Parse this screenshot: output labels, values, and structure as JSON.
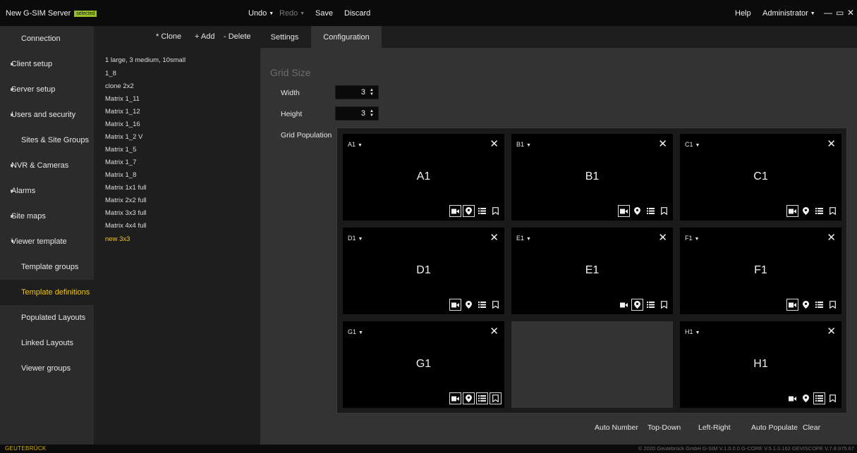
{
  "window": {
    "title": "New G-SIM Server",
    "badge": "selected",
    "menu": {
      "undo": "Undo",
      "redo": "Redo",
      "save": "Save",
      "discard": "Discard",
      "help": "Help",
      "user": "Administrator"
    },
    "controls": {
      "minimize": "—",
      "maximize": "▭",
      "close": "✕"
    }
  },
  "sidebar": {
    "items": [
      {
        "label": "Connection",
        "arrow": ""
      },
      {
        "label": "Client setup",
        "arrow": "►"
      },
      {
        "label": "Server setup",
        "arrow": "►"
      },
      {
        "label": "Users and security",
        "arrow": "►"
      },
      {
        "label": "Sites & Site Groups",
        "arrow": ""
      },
      {
        "label": "NVR & Cameras",
        "arrow": "►"
      },
      {
        "label": "Alarms",
        "arrow": "►"
      },
      {
        "label": "Site maps",
        "arrow": "►"
      },
      {
        "label": "Viewer template",
        "arrow": "▼"
      },
      {
        "label": "Template groups",
        "arrow": ""
      },
      {
        "label": "Template definitions",
        "arrow": "",
        "active": true
      },
      {
        "label": "Populated Layouts",
        "arrow": ""
      },
      {
        "label": "Linked Layouts",
        "arrow": ""
      },
      {
        "label": "Viewer groups",
        "arrow": ""
      }
    ]
  },
  "templates": {
    "actions": {
      "clone": "* Clone",
      "add": "+ Add",
      "delete": "- Delete"
    },
    "items": [
      "1 large, 3 medium, 10small",
      "1_8",
      "clone 2x2",
      "Matrix 1_11",
      "Matrix 1_12",
      "Matrix 1_16",
      "Matrix 1_2 V",
      "Matrix 1_5",
      "Matrix 1_7",
      "Matrix 1_8",
      "Matrix 1x1 full",
      "Matrix 2x2 full",
      "Matrix 3x3 full",
      "Matrix 4x4 full",
      "new 3x3"
    ],
    "selected": "new 3x3"
  },
  "tabs": [
    {
      "label": "Settings",
      "active": false
    },
    {
      "label": "Configuration",
      "active": true
    }
  ],
  "config": {
    "section_title": "Grid Size",
    "width_label": "Width",
    "width_value": "3",
    "height_label": "Height",
    "height_value": "3",
    "population_label": "Grid Population",
    "spin_up": "▲",
    "spin_down": "▼"
  },
  "grid": {
    "cells": [
      {
        "tag": "A1",
        "label": "A1",
        "boxed": [
          true,
          true,
          false,
          false
        ]
      },
      {
        "tag": "B1",
        "label": "B1",
        "boxed": [
          true,
          false,
          false,
          false
        ]
      },
      {
        "tag": "C1",
        "label": "C1",
        "boxed": [
          true,
          false,
          false,
          false
        ]
      },
      {
        "tag": "D1",
        "label": "D1",
        "boxed": [
          true,
          false,
          false,
          false
        ]
      },
      {
        "tag": "E1",
        "label": "E1",
        "boxed": [
          false,
          true,
          false,
          false
        ]
      },
      {
        "tag": "F1",
        "label": "F1",
        "boxed": [
          true,
          false,
          false,
          false
        ]
      },
      {
        "tag": "G1",
        "label": "G1",
        "boxed": [
          true,
          true,
          true,
          true
        ]
      },
      {
        "empty": true
      },
      {
        "tag": "H1",
        "label": "H1",
        "boxed": [
          false,
          false,
          true,
          false
        ]
      }
    ],
    "icon_names": [
      "camera-icon",
      "location-icon",
      "list-icon",
      "bookmark-icon"
    ]
  },
  "bottom_actions": {
    "auto_number": "Auto Number",
    "top_down": "Top-Down",
    "left_right": "Left-Right",
    "auto_populate": "Auto Populate",
    "clear": "Clear"
  },
  "status": {
    "brand": "GEUTEBRÜCK",
    "copyright": "© 2020 Geutebrück GmbH   G-SIM V.1.0.0.0   G-CORE V.5.1.0.162   GEVISCOPE V.7.8.975.67"
  },
  "colors": {
    "accent": "#f0c419",
    "badge": "#98bf2a",
    "panel": "#333333",
    "sidebar": "#2b2b2b"
  }
}
